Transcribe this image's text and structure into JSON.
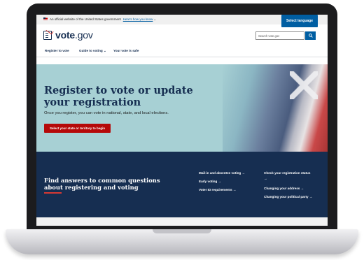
{
  "banner": {
    "text": "An official website of the United States government",
    "link": "Here's how you know",
    "language_button": "Select language"
  },
  "header": {
    "logo_bold": "vote",
    "logo_rest": ".gov",
    "search_placeholder": "Search vote.gov"
  },
  "nav": {
    "items": [
      {
        "label": "Register to vote"
      },
      {
        "label": "Guide to voting"
      },
      {
        "label": "Your vote is safe"
      }
    ]
  },
  "hero": {
    "title": "Register to vote or update your registration",
    "subtitle": "Once you register, you can vote in national, state, and local elections.",
    "cta": "Select your state or territory to begin"
  },
  "faq": {
    "title": "Find answers to common questions about registering and voting",
    "links": [
      {
        "label": "Mail-in and absentee voting →"
      },
      {
        "label": "Early voting →"
      },
      {
        "label": "Voter ID requirements →"
      },
      {
        "label": "Check your registration status"
      },
      {
        "label": "→"
      },
      {
        "label": "Changing your address →"
      },
      {
        "label": "Changing your political party →"
      }
    ]
  },
  "colors": {
    "primary": "#005ea2",
    "navy": "#162e51",
    "cta_red": "#b50909",
    "hero_bg": "#a7d0d4"
  }
}
